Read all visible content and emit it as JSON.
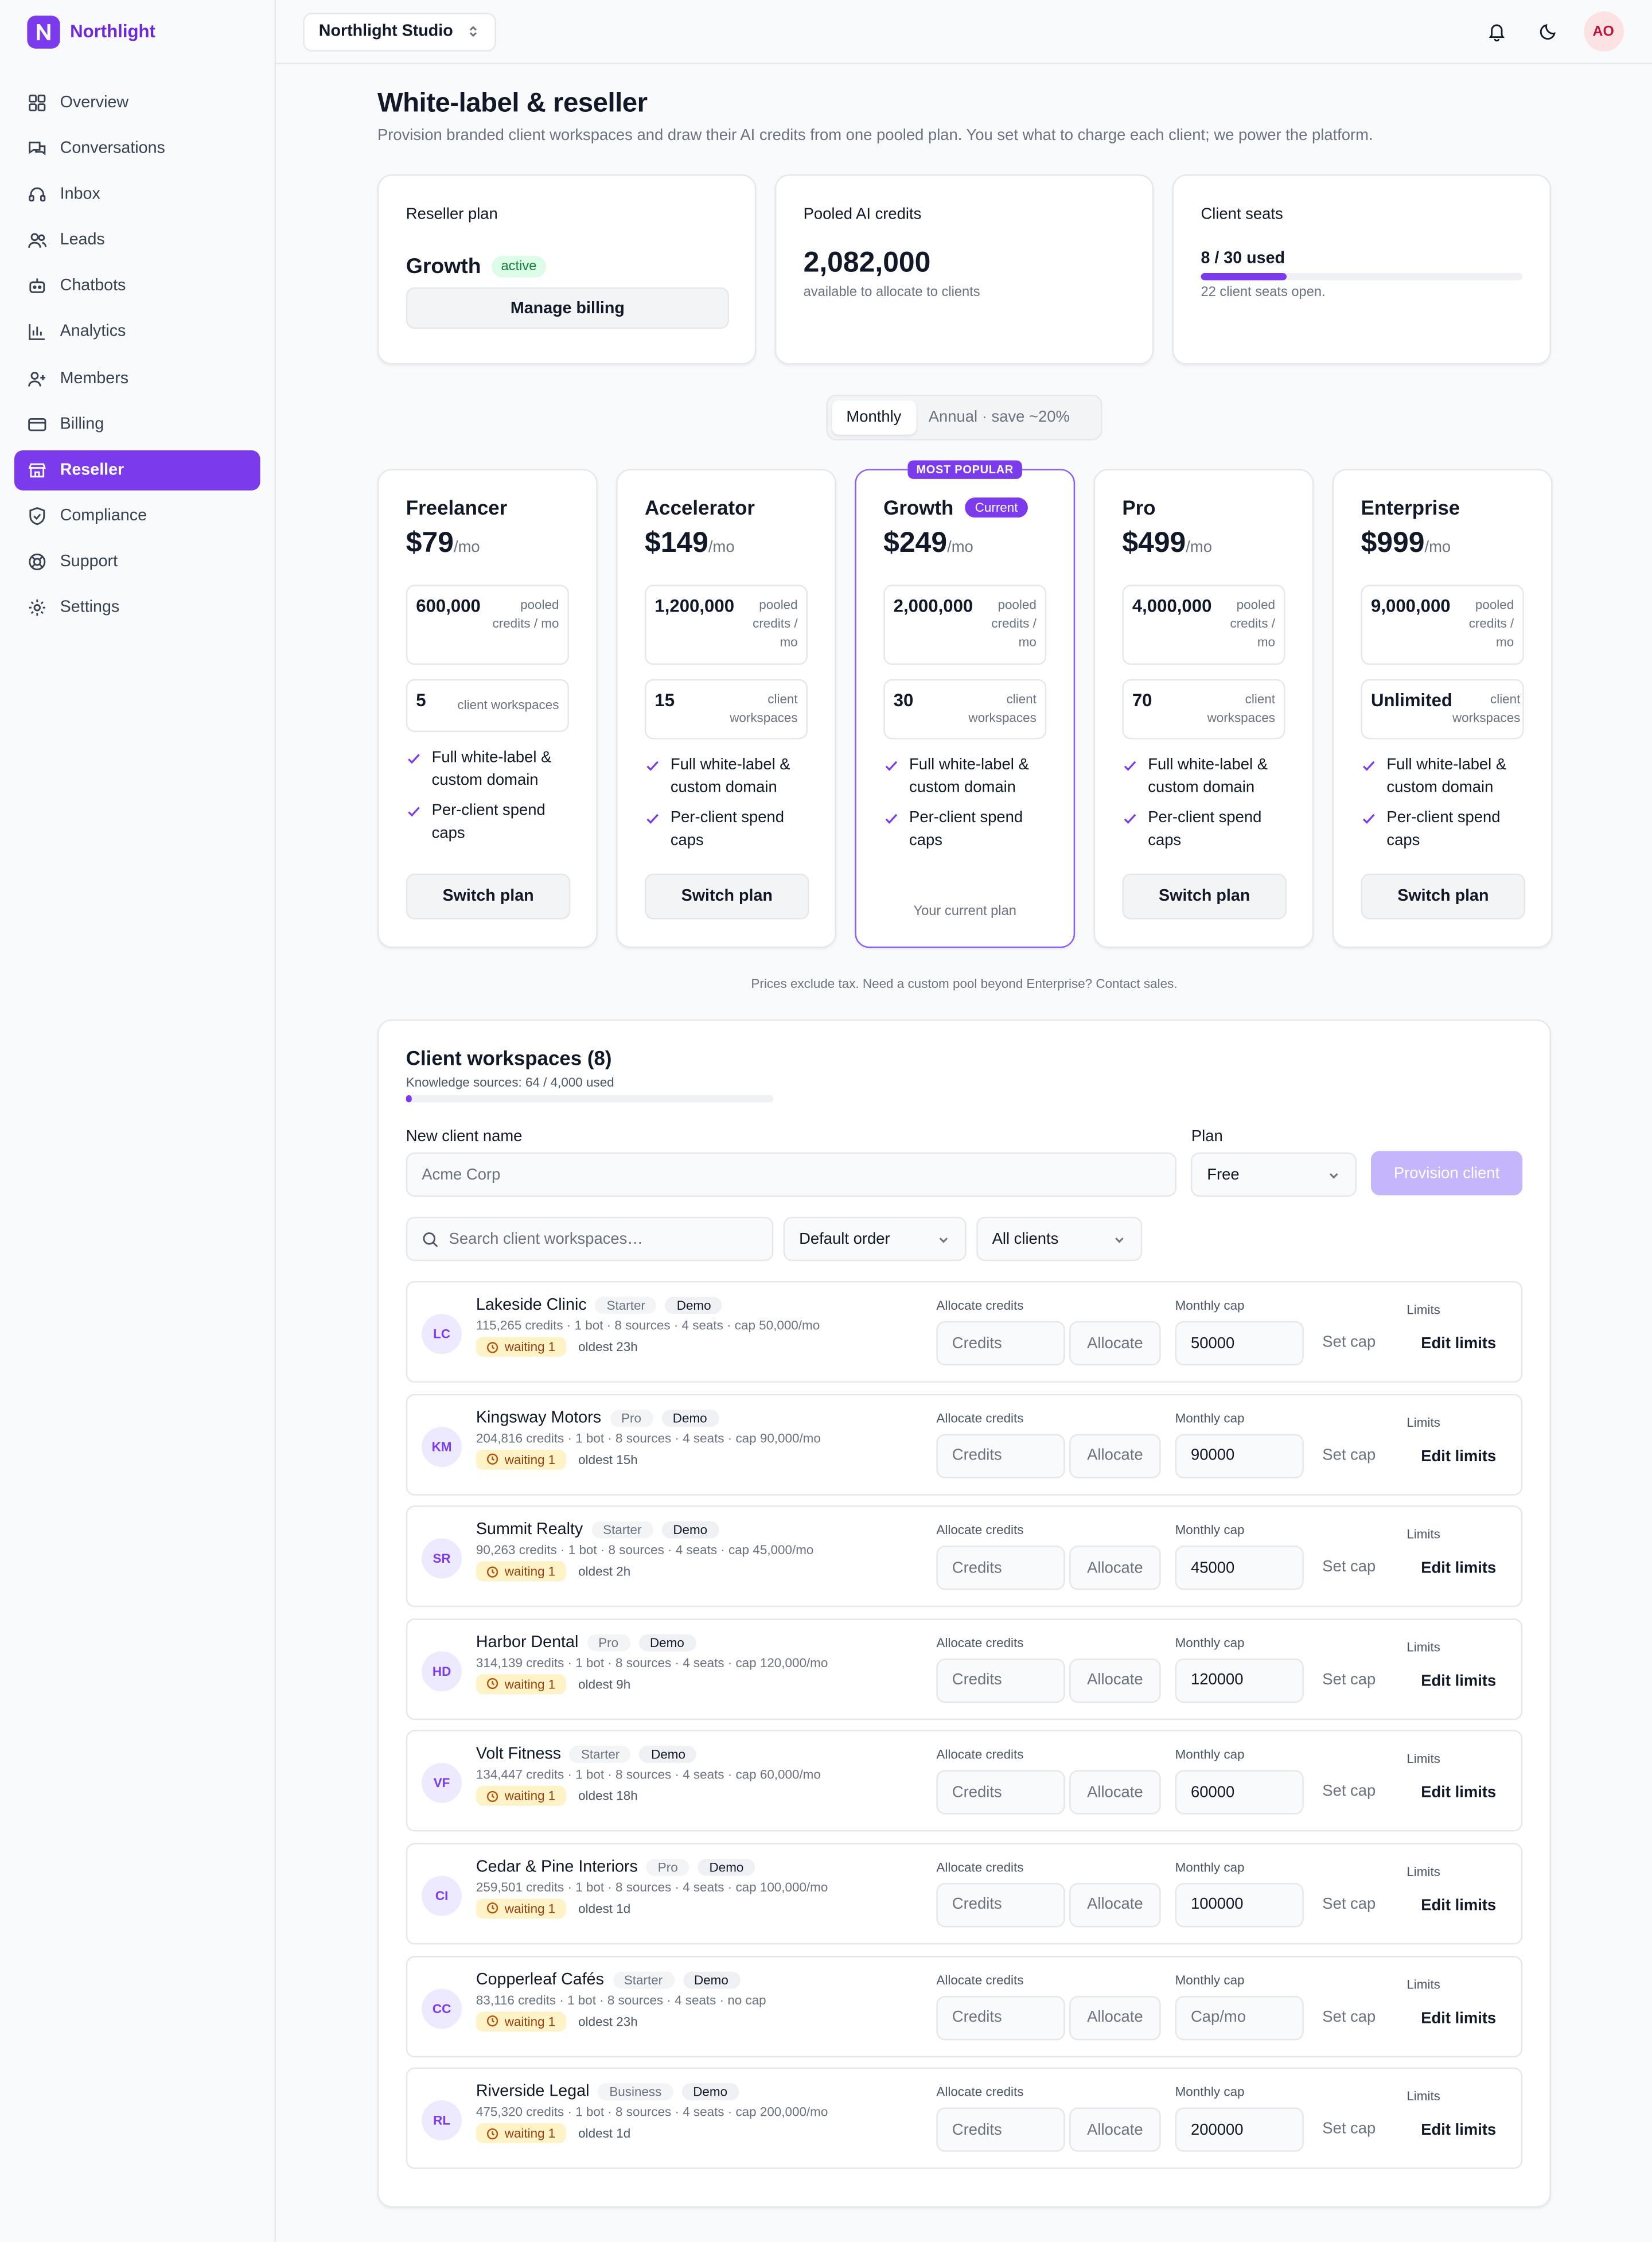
{
  "brand": {
    "name": "Northlight",
    "logo_letter": "N"
  },
  "nav": [
    {
      "label": "Overview",
      "icon": "grid-icon"
    },
    {
      "label": "Conversations",
      "icon": "chat-icon"
    },
    {
      "label": "Inbox",
      "icon": "headset-icon"
    },
    {
      "label": "Leads",
      "icon": "users-icon"
    },
    {
      "label": "Chatbots",
      "icon": "bot-icon"
    },
    {
      "label": "Analytics",
      "icon": "chart-icon"
    },
    {
      "label": "Members",
      "icon": "user-plus-icon"
    },
    {
      "label": "Billing",
      "icon": "card-icon"
    },
    {
      "label": "Reseller",
      "icon": "store-icon",
      "active": true
    },
    {
      "label": "Compliance",
      "icon": "shield-icon"
    },
    {
      "label": "Support",
      "icon": "lifebuoy-icon"
    },
    {
      "label": "Settings",
      "icon": "gear-icon"
    }
  ],
  "topbar": {
    "workspace": "Northlight Studio",
    "avatar_initials": "AO"
  },
  "page": {
    "title": "White-label & reseller",
    "subtitle": "Provision branded client workspaces and draw their AI credits from one pooled plan. You set what to charge each client; we power the platform."
  },
  "stats": {
    "plan": {
      "label": "Reseller plan",
      "name": "Growth",
      "status": "active",
      "button": "Manage billing"
    },
    "credits": {
      "label": "Pooled AI credits",
      "value": "2,082,000",
      "caption": "available to allocate to clients"
    },
    "seats": {
      "label": "Client seats",
      "value": "8 / 30 used",
      "used_fraction": 0.267,
      "caption": "22 client seats open."
    }
  },
  "billing_toggle": {
    "monthly": "Monthly",
    "annual": "Annual · save ~20%"
  },
  "plans": [
    {
      "name": "Freelancer",
      "price": "$79",
      "per": "/mo",
      "credits": "600,000",
      "credits_label": "pooled credits / mo",
      "workspaces": "5",
      "workspaces_label": "client workspaces",
      "features": [
        "Full white-label & custom domain",
        "Per-client spend caps"
      ],
      "button": "Switch plan"
    },
    {
      "name": "Accelerator",
      "price": "$149",
      "per": "/mo",
      "credits": "1,200,000",
      "credits_label": "pooled credits / mo",
      "workspaces": "15",
      "workspaces_label": "client workspaces",
      "features": [
        "Full white-label & custom domain",
        "Per-client spend caps"
      ],
      "button": "Switch plan"
    },
    {
      "name": "Growth",
      "price": "$249",
      "per": "/mo",
      "credits": "2,000,000",
      "credits_label": "pooled credits / mo",
      "workspaces": "30",
      "workspaces_label": "client workspaces",
      "features": [
        "Full white-label & custom domain",
        "Per-client spend caps"
      ],
      "ribbon": "MOST POPULAR",
      "badge": "Current",
      "current_text": "Your current plan",
      "current": true
    },
    {
      "name": "Pro",
      "price": "$499",
      "per": "/mo",
      "credits": "4,000,000",
      "credits_label": "pooled credits / mo",
      "workspaces": "70",
      "workspaces_label": "client workspaces",
      "features": [
        "Full white-label & custom domain",
        "Per-client spend caps"
      ],
      "button": "Switch plan"
    },
    {
      "name": "Enterprise",
      "price": "$999",
      "per": "/mo",
      "credits": "9,000,000",
      "credits_label": "pooled credits / mo",
      "workspaces": "Unlimited",
      "workspaces_label": "client workspaces",
      "features": [
        "Full white-label & custom domain",
        "Per-client spend caps"
      ],
      "button": "Switch plan"
    }
  ],
  "pricing_note": "Prices exclude tax. Need a custom pool beyond Enterprise? Contact sales.",
  "clients": {
    "title": "Client workspaces (8)",
    "knowledge": "Knowledge sources: 64 / 4,000 used",
    "knowledge_fraction": 0.016,
    "new_client_label": "New client name",
    "new_client_placeholder": "Acme Corp",
    "plan_label": "Plan",
    "plan_value": "Free",
    "provision": "Provision client",
    "search_placeholder": "Search client workspaces…",
    "order": "Default order",
    "filter": "All clients",
    "col_alloc": "Allocate credits",
    "col_cap": "Monthly cap",
    "col_limits": "Limits",
    "credits_placeholder": "Credits",
    "allocate": "Allocate",
    "cap_placeholder": "Cap/mo",
    "set_cap": "Set cap",
    "edit_limits": "Edit limits",
    "rows": [
      {
        "initials": "LC",
        "name": "Lakeside Clinic",
        "tier": "Starter",
        "tag": "Demo",
        "meta": "115,265 credits · 1 bot · 8 sources · 4 seats · cap 50,000/mo",
        "waiting": "waiting 1",
        "oldest": "oldest 23h",
        "cap": "50000"
      },
      {
        "initials": "KM",
        "name": "Kingsway Motors",
        "tier": "Pro",
        "tag": "Demo",
        "meta": "204,816 credits · 1 bot · 8 sources · 4 seats · cap 90,000/mo",
        "waiting": "waiting 1",
        "oldest": "oldest 15h",
        "cap": "90000"
      },
      {
        "initials": "SR",
        "name": "Summit Realty",
        "tier": "Starter",
        "tag": "Demo",
        "meta": "90,263 credits · 1 bot · 8 sources · 4 seats · cap 45,000/mo",
        "waiting": "waiting 1",
        "oldest": "oldest 2h",
        "cap": "45000"
      },
      {
        "initials": "HD",
        "name": "Harbor Dental",
        "tier": "Pro",
        "tag": "Demo",
        "meta": "314,139 credits · 1 bot · 8 sources · 4 seats · cap 120,000/mo",
        "waiting": "waiting 1",
        "oldest": "oldest 9h",
        "cap": "120000"
      },
      {
        "initials": "VF",
        "name": "Volt Fitness",
        "tier": "Starter",
        "tag": "Demo",
        "meta": "134,447 credits · 1 bot · 8 sources · 4 seats · cap 60,000/mo",
        "waiting": "waiting 1",
        "oldest": "oldest 18h",
        "cap": "60000"
      },
      {
        "initials": "CI",
        "name": "Cedar & Pine Interiors",
        "tier": "Pro",
        "tag": "Demo",
        "meta": "259,501 credits · 1 bot · 8 sources · 4 seats · cap 100,000/mo",
        "waiting": "waiting 1",
        "oldest": "oldest 1d",
        "cap": "100000"
      },
      {
        "initials": "CC",
        "name": "Copperleaf Cafés",
        "tier": "Starter",
        "tag": "Demo",
        "meta": "83,116 credits · 1 bot · 8 sources · 4 seats · no cap",
        "waiting": "waiting 1",
        "oldest": "oldest 23h",
        "cap": ""
      },
      {
        "initials": "RL",
        "name": "Riverside Legal",
        "tier": "Business",
        "tag": "Demo",
        "meta": "475,320 credits · 1 bot · 8 sources · 4 seats · cap 200,000/mo",
        "waiting": "waiting 1",
        "oldest": "oldest 1d",
        "cap": "200000"
      }
    ]
  }
}
